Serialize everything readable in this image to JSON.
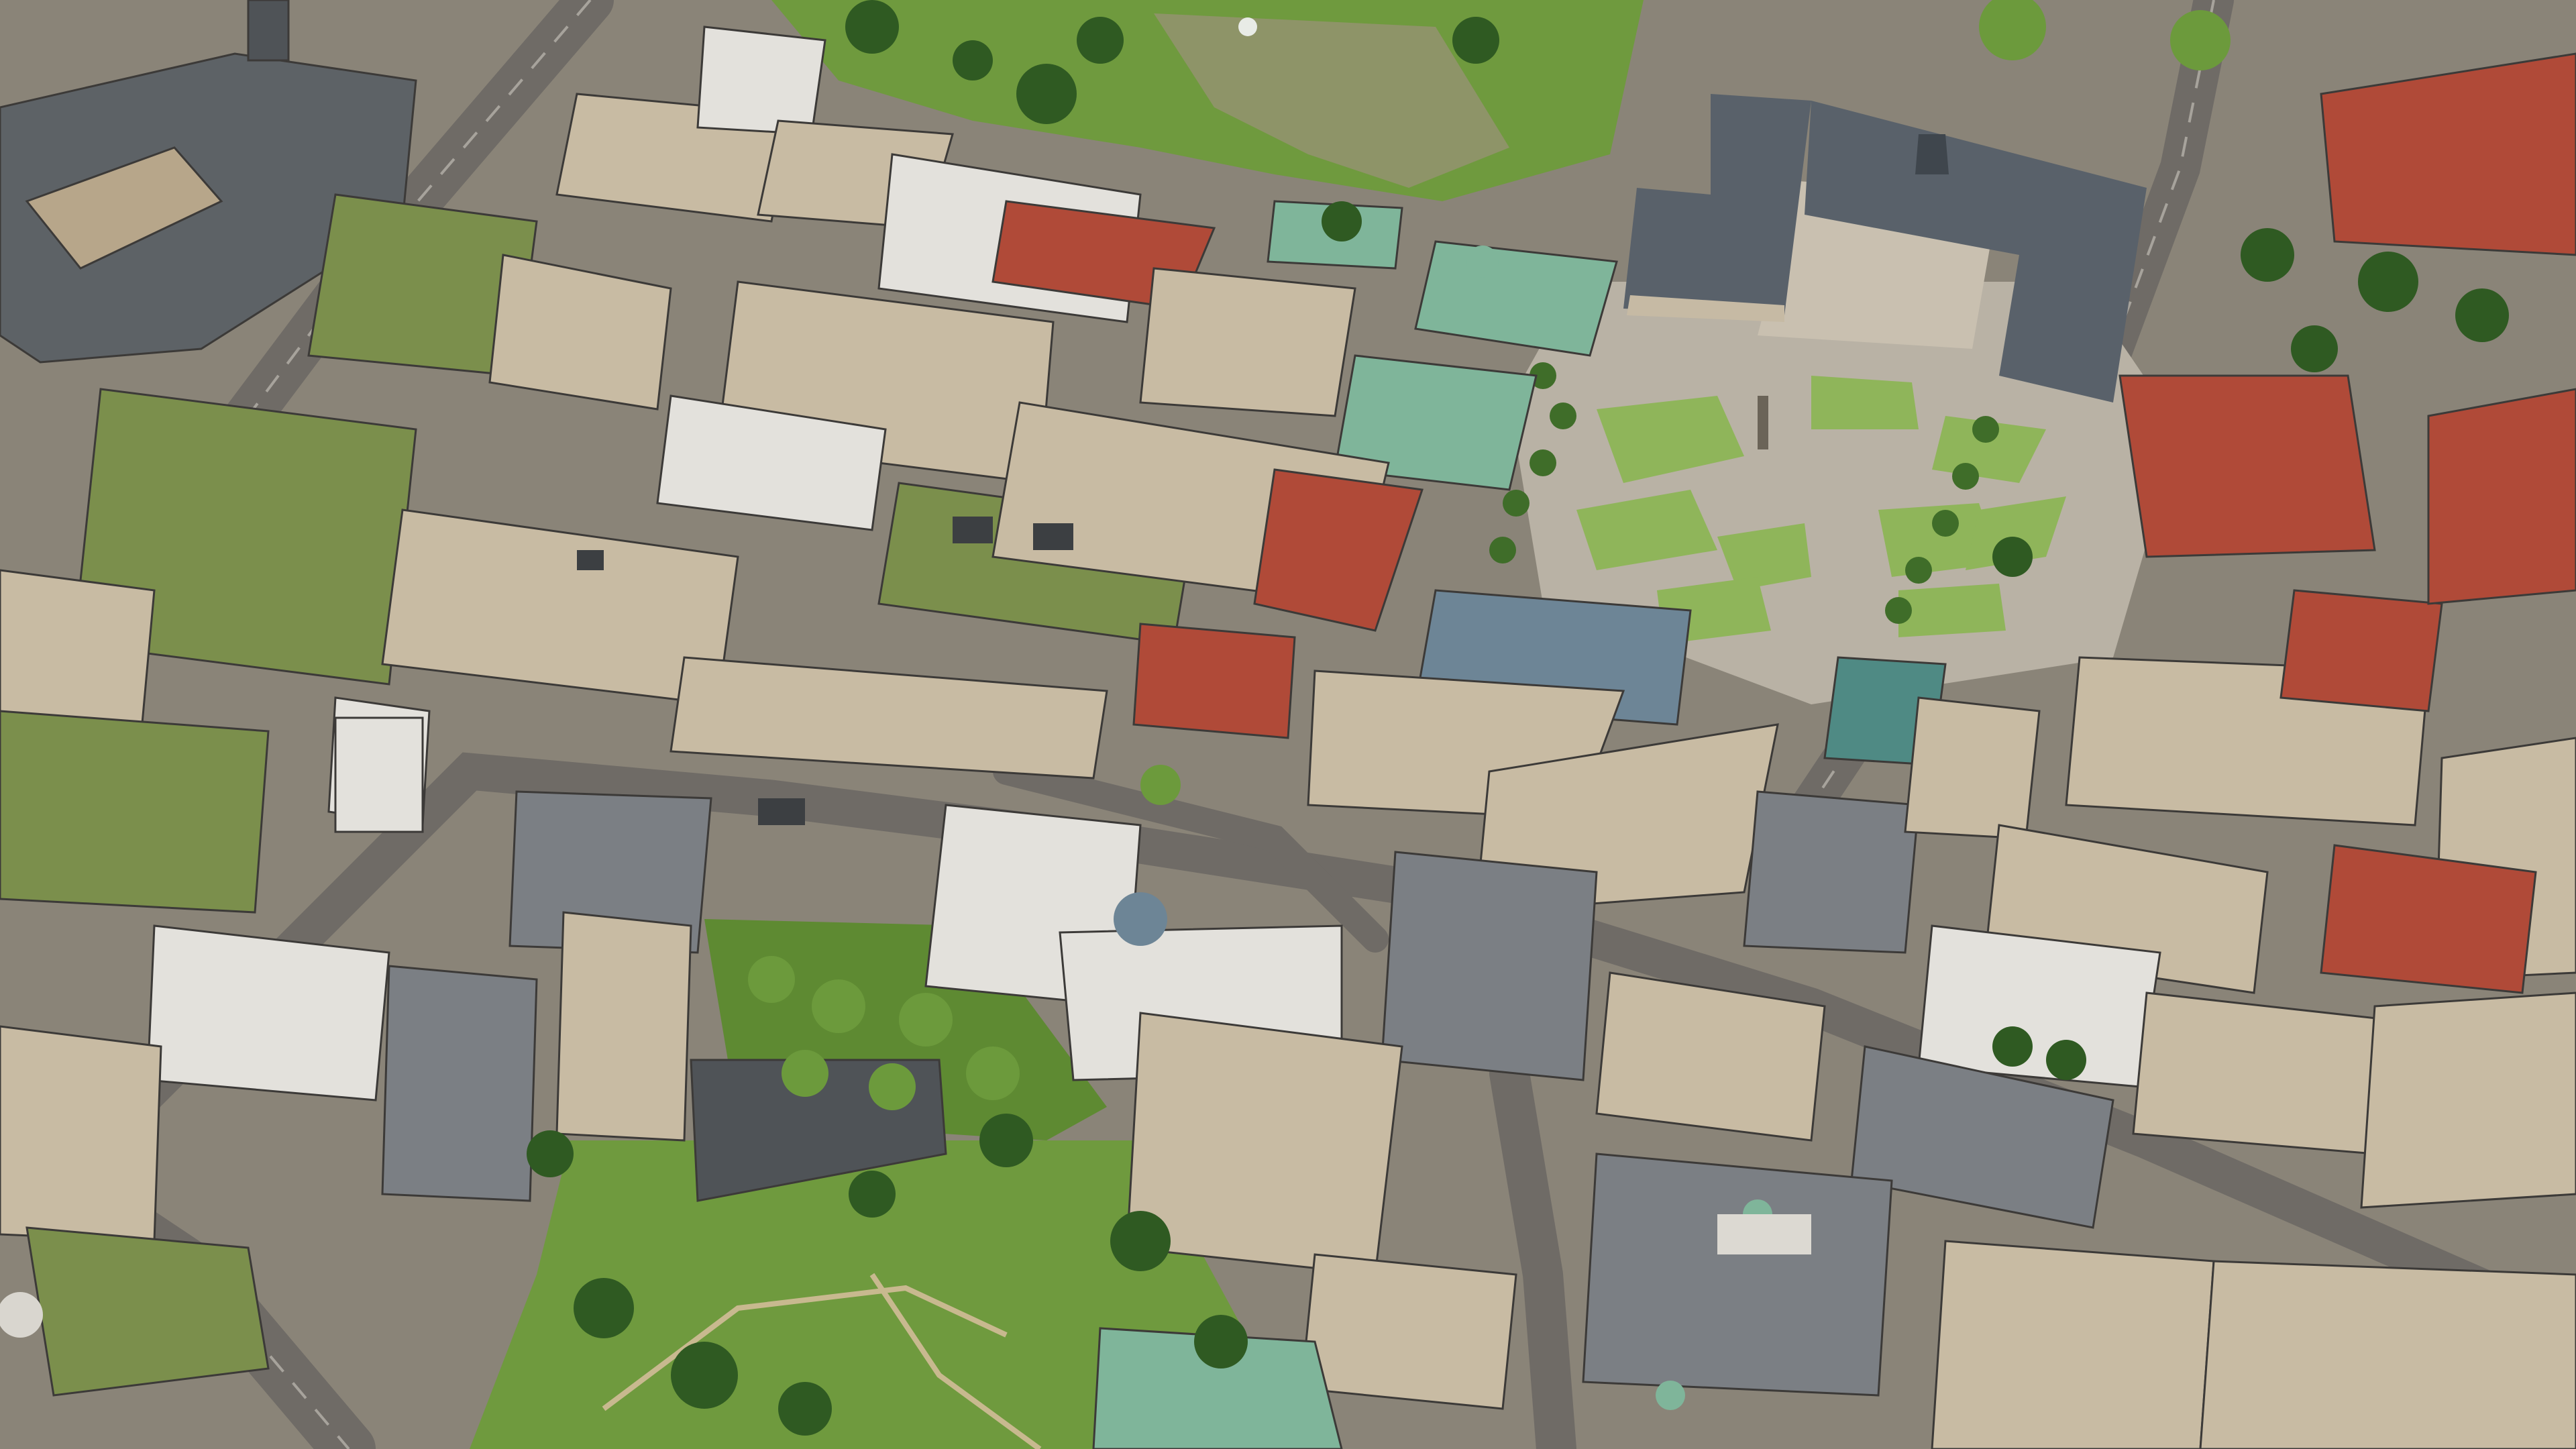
{
  "image": {
    "kind": "oblique aerial photograph",
    "description_visible": false
  },
  "palette": {
    "ground": "#8a8478",
    "pavement": "#b9b2a5",
    "road": "#6f6b66",
    "road_light": "#a7a39c",
    "park_grass": "#6f9a3e",
    "park_grass_light": "#8fb55a",
    "tree_dark": "#2f5a22",
    "tree_mid": "#4a7a2e",
    "tree_light": "#6c9a3c",
    "roof_grey": "#7c7f82",
    "roof_dark": "#4f5357",
    "roof_beige": "#c8bba3",
    "roof_white": "#e3e1dc",
    "roof_red": "#b04a38",
    "roof_copper": "#7fb59a",
    "green_roof": "#7b8f4c",
    "glass": "#6d8596",
    "water": "#8e9468"
  },
  "scene": {
    "parks": [
      "palace-square-lawns",
      "upper-park",
      "lower-park",
      "tree-grove"
    ],
    "landmarks": [
      "palace-building",
      "central-column",
      "glass-cube-building",
      "main-station-complex",
      "fountain-pond"
    ]
  }
}
